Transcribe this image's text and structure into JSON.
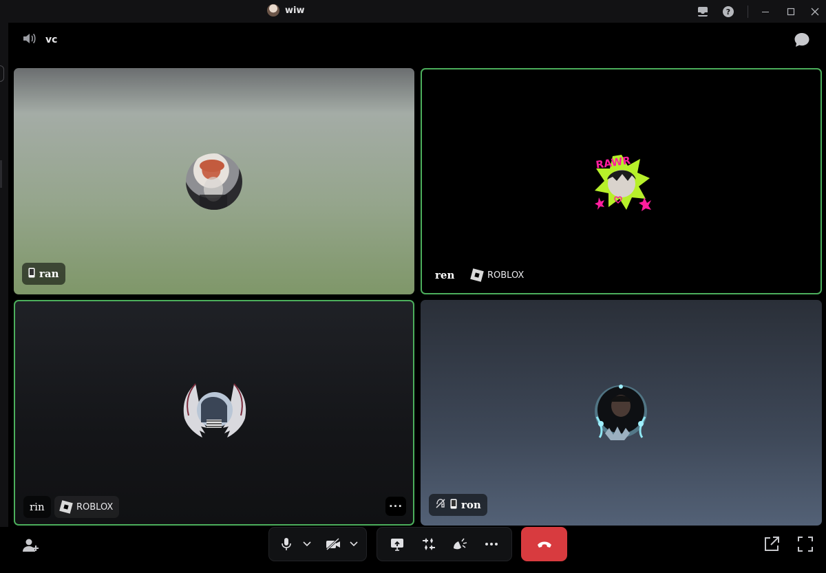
{
  "window": {
    "title": "wiw"
  },
  "channel": {
    "name": "vc"
  },
  "participants": [
    {
      "name": "ran",
      "device": "mobile-icon",
      "game": null,
      "speaking": false
    },
    {
      "name": "ren",
      "device": null,
      "game": "ROBLOX",
      "speaking": true
    },
    {
      "name": "rin",
      "device": null,
      "game": "ROBLOX",
      "speaking": true
    },
    {
      "name": "ron",
      "device": "mobile-icon",
      "game": null,
      "speaking": false,
      "deafened": true
    }
  ],
  "tile_menu": {
    "more_label": "···"
  },
  "controls": {
    "hangup_color": "#d83b3f",
    "speaking_ring_color": "#4caf5c"
  }
}
